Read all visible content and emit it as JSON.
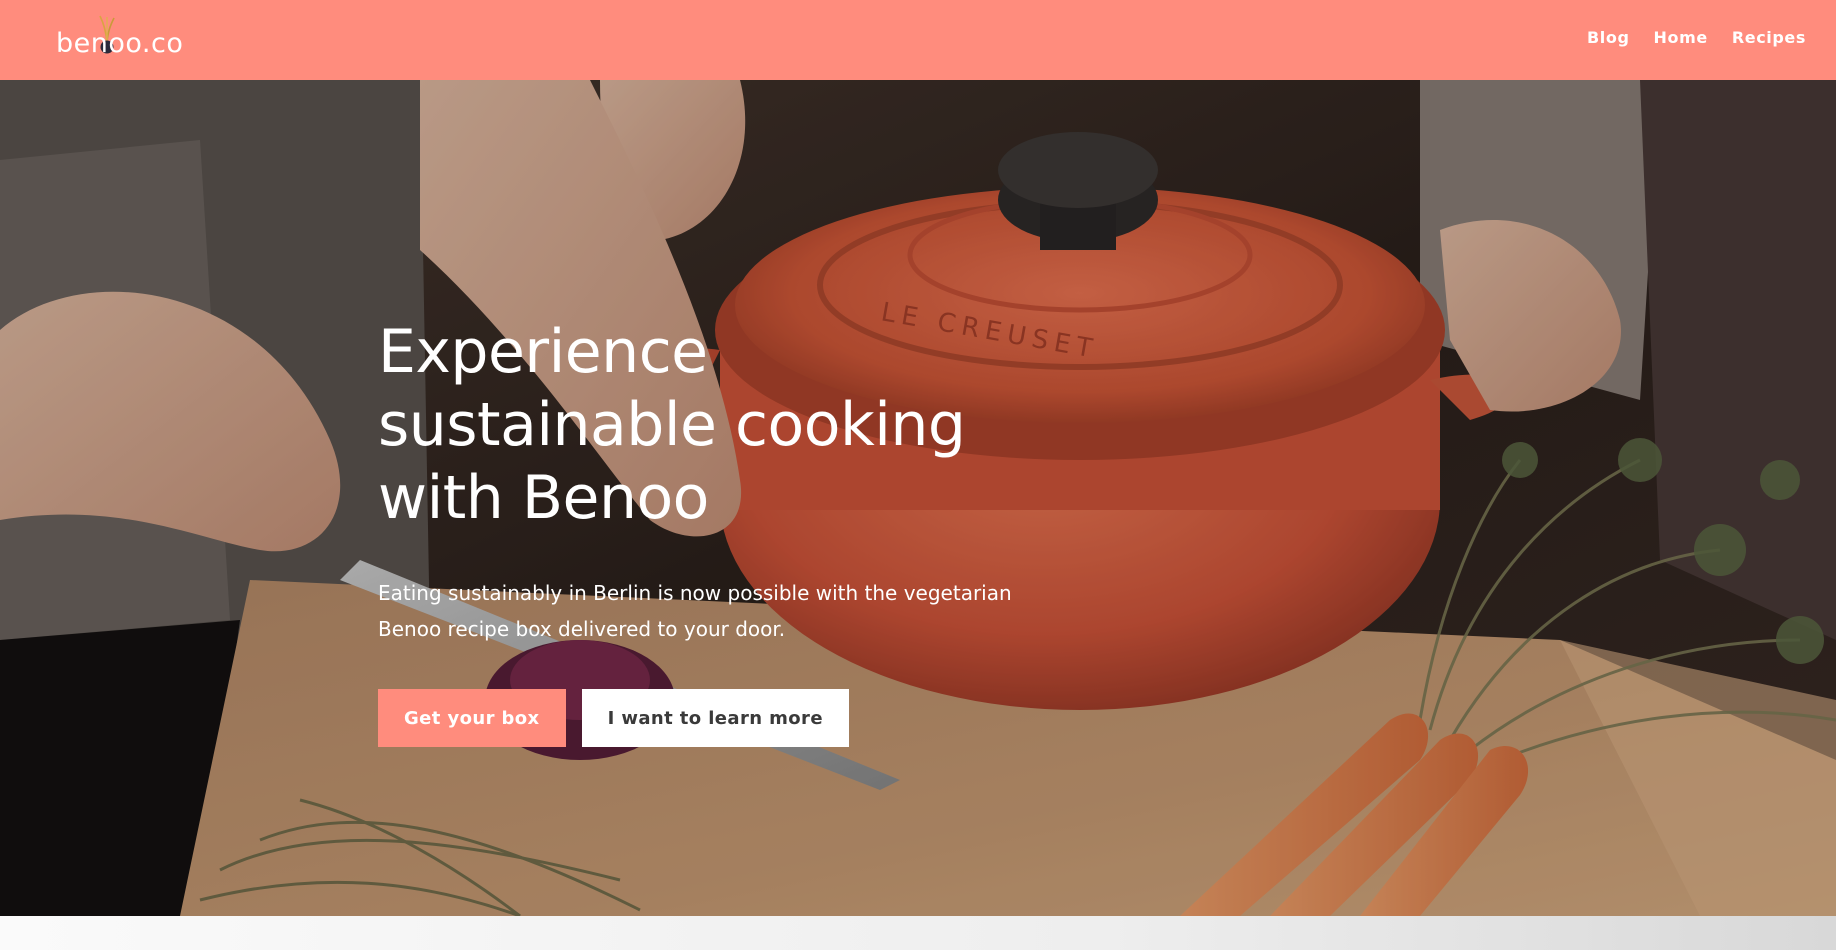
{
  "header": {
    "logo_text": "benoo.co",
    "nav": [
      {
        "label": "Blog"
      },
      {
        "label": "Home"
      },
      {
        "label": "Recipes"
      }
    ],
    "background_color": "#ff8c7d"
  },
  "hero": {
    "title": "Experience sustainable cooking with Benoo",
    "subtitle": "Eating sustainably in Berlin is now possible with the vegetarian Benoo recipe box delivered to your door.",
    "primary_button": "Get your box",
    "secondary_button": "I want to learn more",
    "pot_lettering": "LE CREUSET"
  },
  "colors": {
    "accent": "#ff8c7d",
    "pot": "#d9583a",
    "carrot": "#e8874a"
  }
}
